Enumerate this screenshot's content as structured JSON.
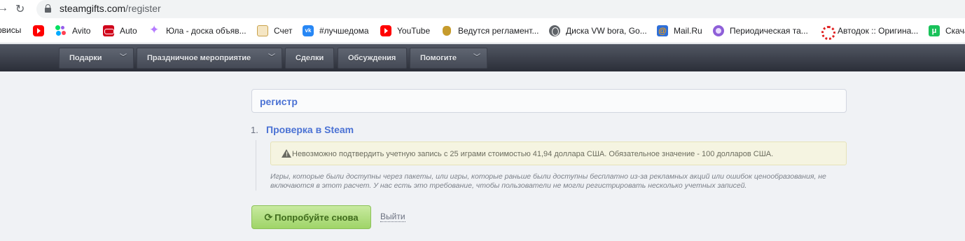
{
  "browser": {
    "url_host": "steamgifts.com",
    "url_path": "/register",
    "bookmarks": [
      {
        "label": "рвисы",
        "icon": "none"
      },
      {
        "label": "",
        "icon": "youtube-icon"
      },
      {
        "label": "Avito",
        "icon": "avito-icon"
      },
      {
        "label": "Auto",
        "icon": "auto-icon"
      },
      {
        "label": "Юла - доска объяв...",
        "icon": "yula-icon"
      },
      {
        "label": "Счет",
        "icon": "invoice-icon"
      },
      {
        "label": "#лучшедома",
        "icon": "vk-icon"
      },
      {
        "label": "YouTube",
        "icon": "youtube-icon"
      },
      {
        "label": "Ведутся регламент...",
        "icon": "coat-of-arms-icon"
      },
      {
        "label": "Диска VW bora, Go...",
        "icon": "globe-icon"
      },
      {
        "label": "Mail.Ru",
        "icon": "mailru-icon"
      },
      {
        "label": "Периодическая та...",
        "icon": "periodic-table-icon"
      },
      {
        "label": "Автодок :: Оригина...",
        "icon": "avtodok-icon"
      },
      {
        "label": "Скача",
        "icon": "download-icon"
      }
    ]
  },
  "site_nav": [
    {
      "label": "Подарки",
      "dropdown": true
    },
    {
      "label": "Праздничное мероприятие",
      "dropdown": true
    },
    {
      "label": "Сделки",
      "dropdown": false
    },
    {
      "label": "Обсуждения",
      "dropdown": false
    },
    {
      "label": "Помогите",
      "dropdown": true
    }
  ],
  "main": {
    "heading": "регистр",
    "step_number": "1.",
    "step_title": "Проверка в Steam",
    "warning": "Невозможно подтвердить учетную запись с 25 играми стоимостью 41,94 доллара США. Обязательное значение - 100 долларов США.",
    "note": "Игры, которые были доступны через пакеты, или игры, которые раньше были доступны бесплатно из-за рекламных акций или ошибок ценообразования, не включаются в этот расчет. У нас есть это требование, чтобы пользователи не могли регистрировать несколько учетных записей.",
    "retry_label": "Попробуйте снова",
    "logout_label": "Выйти"
  },
  "colors": {
    "accent_blue": "#4b72d4",
    "retry_green": "#9fd468",
    "nav_dark": "#2b2e38",
    "warning_bg": "#f5f4e1"
  }
}
